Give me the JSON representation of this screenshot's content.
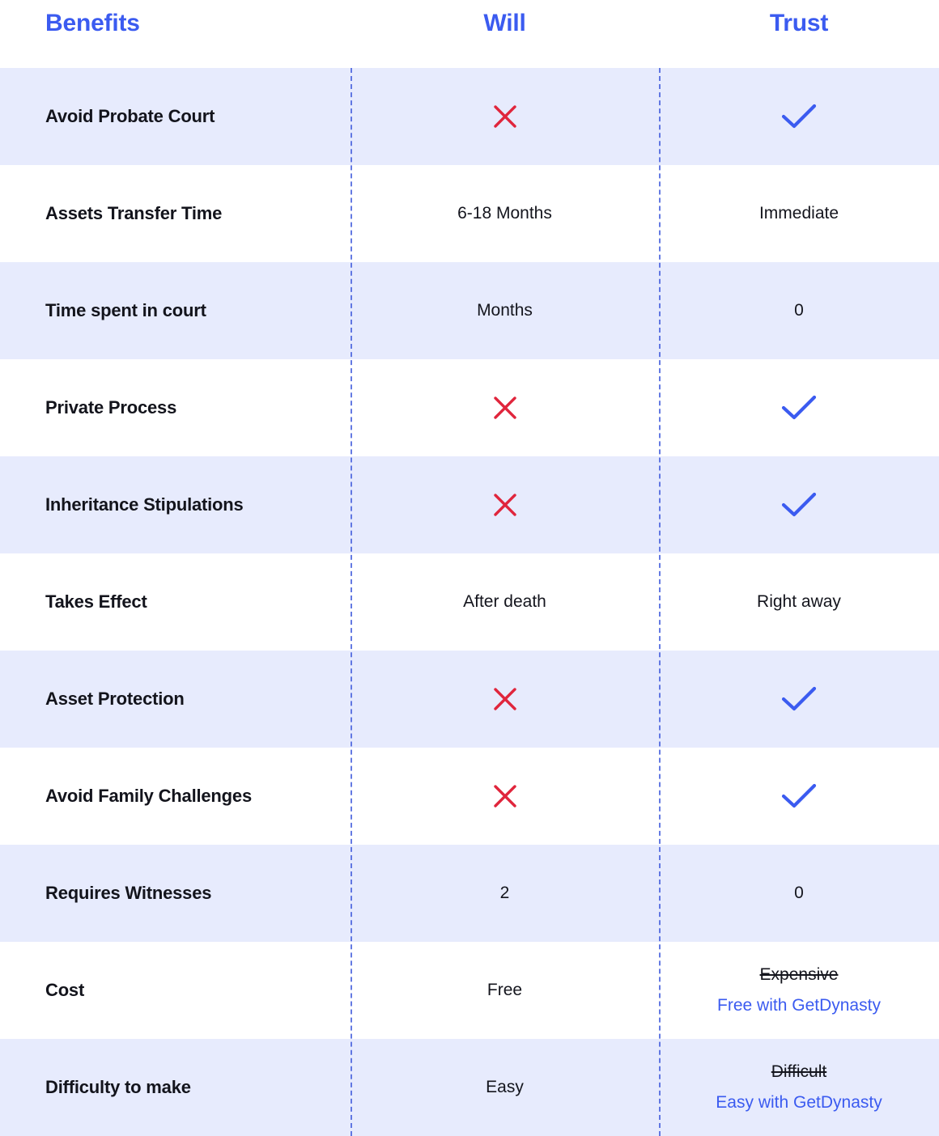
{
  "header": {
    "benefits_label": "Benefits",
    "will_label": "Will",
    "trust_label": "Trust"
  },
  "colors": {
    "accent_blue": "#3b5bf0",
    "check_blue": "#3b5bf0",
    "cross_red": "#e0253c",
    "row_shaded_bg": "#e7ebfd",
    "row_plain_bg": "#ffffff",
    "text_dark": "#13141c",
    "divider": "#4a63de"
  },
  "rows": [
    {
      "benefit": "Avoid Probate Court",
      "will": {
        "kind": "cross",
        "icon": "cross-icon"
      },
      "trust": {
        "kind": "check",
        "icon": "check-icon"
      },
      "shaded": true
    },
    {
      "benefit": "Assets Transfer Time",
      "will": {
        "kind": "text",
        "text": "6-18 Months"
      },
      "trust": {
        "kind": "text",
        "text": "Immediate"
      },
      "shaded": false
    },
    {
      "benefit": "Time spent in court",
      "will": {
        "kind": "text",
        "text": "Months"
      },
      "trust": {
        "kind": "text",
        "text": "0"
      },
      "shaded": true
    },
    {
      "benefit": "Private Process",
      "will": {
        "kind": "cross",
        "icon": "cross-icon"
      },
      "trust": {
        "kind": "check",
        "icon": "check-icon"
      },
      "shaded": false
    },
    {
      "benefit": "Inheritance Stipulations",
      "will": {
        "kind": "cross",
        "icon": "cross-icon"
      },
      "trust": {
        "kind": "check",
        "icon": "check-icon"
      },
      "shaded": true
    },
    {
      "benefit": "Takes Effect",
      "will": {
        "kind": "text",
        "text": "After death"
      },
      "trust": {
        "kind": "text",
        "text": "Right away"
      },
      "shaded": false
    },
    {
      "benefit": "Asset Protection",
      "will": {
        "kind": "cross",
        "icon": "cross-icon"
      },
      "trust": {
        "kind": "check",
        "icon": "check-icon"
      },
      "shaded": true
    },
    {
      "benefit": "Avoid Family Challenges",
      "will": {
        "kind": "cross",
        "icon": "cross-icon"
      },
      "trust": {
        "kind": "check",
        "icon": "check-icon"
      },
      "shaded": false
    },
    {
      "benefit": "Requires Witnesses",
      "will": {
        "kind": "text",
        "text": "2"
      },
      "trust": {
        "kind": "text",
        "text": "0"
      },
      "shaded": true
    },
    {
      "benefit": "Cost",
      "will": {
        "kind": "text",
        "text": "Free"
      },
      "trust": {
        "kind": "stack",
        "struck": "Expensive",
        "promo": "Free with GetDynasty"
      },
      "shaded": false
    },
    {
      "benefit": "Difficulty to make",
      "will": {
        "kind": "text",
        "text": "Easy"
      },
      "trust": {
        "kind": "stack",
        "struck": "Difficult",
        "promo": "Easy with GetDynasty"
      },
      "shaded": true
    }
  ]
}
